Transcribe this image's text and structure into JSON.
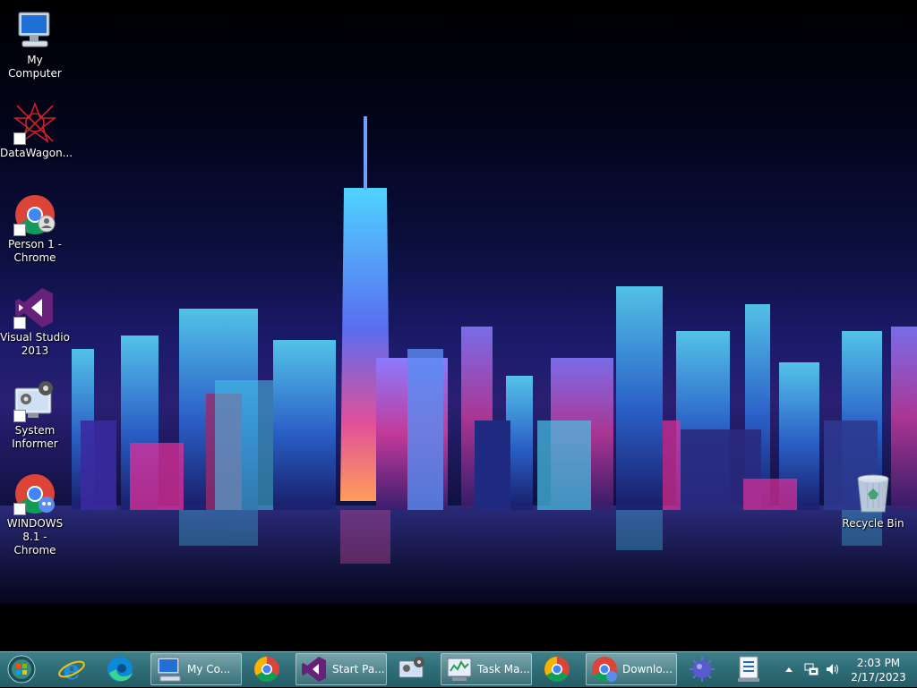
{
  "desktop": {
    "icons": [
      {
        "label": "My Computer",
        "icon": "computer-icon"
      },
      {
        "label": "DataWagon...",
        "icon": "datawagon-icon"
      },
      {
        "label": "Person 1 -\nChrome",
        "icon": "chrome-profile-icon"
      },
      {
        "label": "Visual Studio\n2013",
        "icon": "visual-studio-icon"
      },
      {
        "label": "System\nInformer",
        "icon": "system-informer-icon"
      },
      {
        "label": "WINDOWS\n8.1 - Chrome",
        "icon": "chrome-profile-icon"
      },
      {
        "label": "Recycle Bin",
        "icon": "recycle-bin-icon"
      }
    ]
  },
  "taskbar": {
    "pinned": [
      {
        "icon": "start-orb-icon"
      },
      {
        "icon": "internet-explorer-icon"
      },
      {
        "icon": "edge-icon"
      }
    ],
    "buttons": [
      {
        "label": "My Co...",
        "icon": "computer-icon"
      },
      {
        "label": "",
        "icon": "chrome-icon"
      },
      {
        "label": "Start Pa...",
        "icon": "visual-studio-icon"
      },
      {
        "label": "",
        "icon": "system-informer-icon"
      },
      {
        "label": "Task Ma...",
        "icon": "task-manager-icon"
      },
      {
        "label": "",
        "icon": "chrome-icon"
      },
      {
        "label": "Downlo...",
        "icon": "chrome-profile-icon"
      },
      {
        "label": "",
        "icon": "virus-icon"
      },
      {
        "label": "",
        "icon": "checklist-icon"
      }
    ]
  },
  "tray": {
    "time": "2:03 PM",
    "date": "2/17/2023",
    "icons": [
      "show-hidden-icons-icon",
      "network-icon",
      "volume-icon"
    ]
  },
  "colors": {
    "taskbar": "#2f6e78",
    "wallpaper_sky": "#0b0f3d",
    "neon_cyan": "#3fd6ff",
    "neon_magenta": "#e0309a"
  }
}
